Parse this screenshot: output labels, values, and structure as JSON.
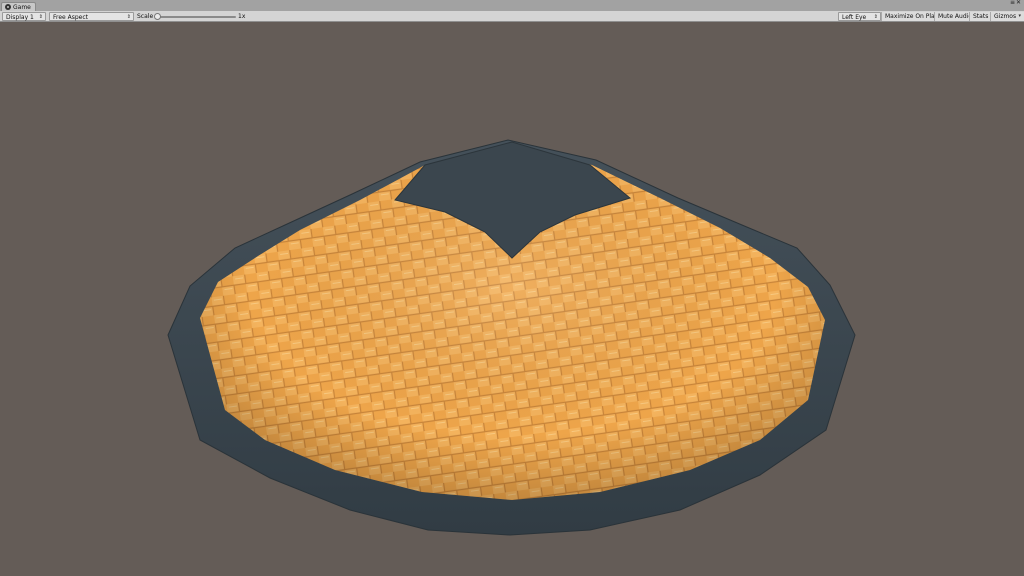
{
  "tab": {
    "label": "Game"
  },
  "toolbar": {
    "display": "Display 1",
    "aspect": "Free Aspect",
    "scale_label": "Scale",
    "scale_value": "1x",
    "eye": "Left Eye",
    "maximize": "Maximize On Play",
    "mute": "Mute Audio",
    "stats": "Stats",
    "gizmos": "Gizmos"
  },
  "colors": {
    "viewport_bg": "#645c57",
    "weave_orange": "#f0a445",
    "rim_slate": "#3d4850"
  },
  "icons": {
    "tab": "game-controller-icon",
    "dropdown": "chevron-updown-icon",
    "window_menu": "menu-icon",
    "window_close": "close-icon"
  }
}
